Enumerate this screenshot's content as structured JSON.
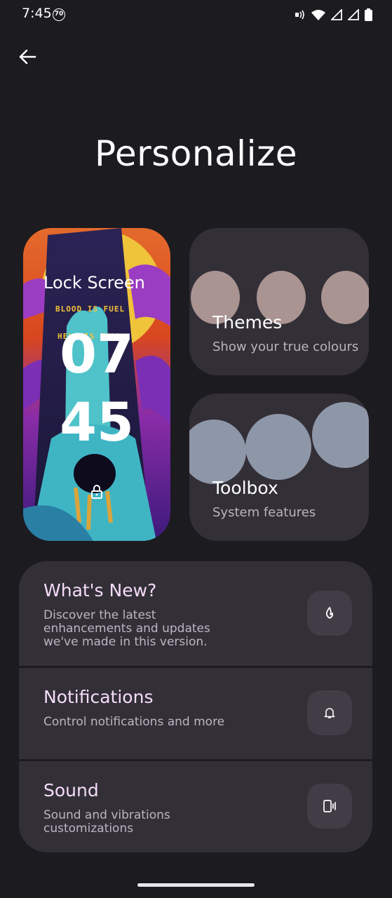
{
  "status_bar": {
    "time": "7:45",
    "badge": "70",
    "icons": [
      "nfc-icon",
      "wifi-icon",
      "signal-icon",
      "signal-icon",
      "battery-icon"
    ]
  },
  "header": {
    "back_icon": "arrow-left-icon",
    "title": "Personalize"
  },
  "lock_screen": {
    "label": "Lock Screen",
    "wallpaper_text_1": "BLOOD IS FUEL",
    "wallpaper_text_2": "HELL IS FULL",
    "hour": "07",
    "minute": "45",
    "lock_icon": "padlock-icon"
  },
  "tiles": [
    {
      "title": "Themes",
      "subtitle": "Show your true colours",
      "blob_color": "#a99492"
    },
    {
      "title": "Toolbox",
      "subtitle": "System features",
      "blob_color": "#8e97a8"
    }
  ],
  "settings": [
    {
      "title": "What's New?",
      "description": "Discover the latest enhancements and updates we've made in this version.",
      "icon": "flame-icon"
    },
    {
      "title": "Notifications",
      "description": "Control notifications and more",
      "icon": "bell-icon"
    },
    {
      "title": "Sound",
      "description": "Sound and vibrations customizations",
      "icon": "phone-vibrate-icon"
    }
  ],
  "colors": {
    "background": "#1c1b1f",
    "card": "#332f37",
    "row_title": "#f4dcf8"
  }
}
